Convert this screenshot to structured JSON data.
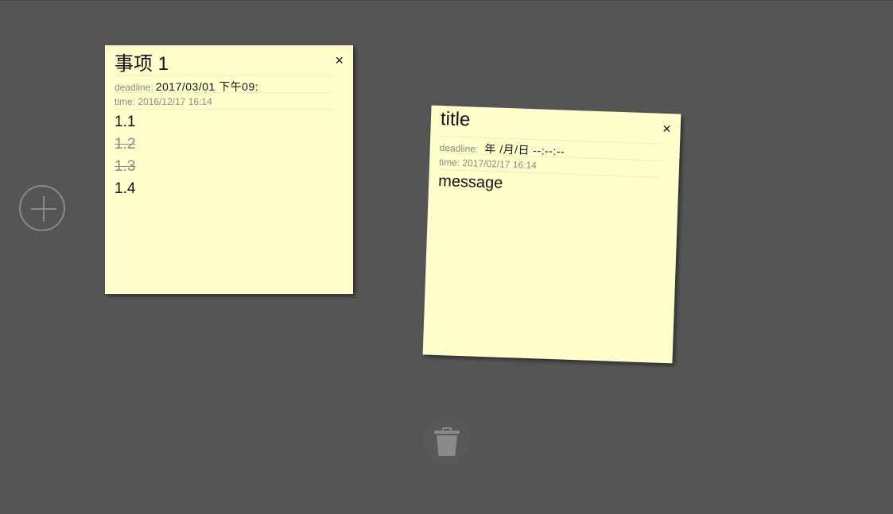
{
  "notes": [
    {
      "title": "事项 1",
      "close_label": "×",
      "deadline_label": "deadline:",
      "deadline_value": "2017/03/01 下午09:",
      "time_label": "time:",
      "time_value": "2016/12/17 16:14",
      "items": [
        {
          "text": "1.1",
          "done": false
        },
        {
          "text": "1.2",
          "done": true
        },
        {
          "text": "1.3",
          "done": true
        },
        {
          "text": "1.4",
          "done": false
        }
      ]
    },
    {
      "title": "title",
      "close_label": "×",
      "deadline_label": "deadline:",
      "deadline_value": "年 /月/日 --:--:--",
      "time_label": "time:",
      "time_value": "2017/02/17 16:14",
      "message": "message"
    }
  ],
  "controls": {
    "add_icon": "plus-circle-icon",
    "trash_icon": "trash-icon"
  },
  "colors": {
    "background": "#555555",
    "note": "#ffffcc",
    "muted": "#888888"
  }
}
